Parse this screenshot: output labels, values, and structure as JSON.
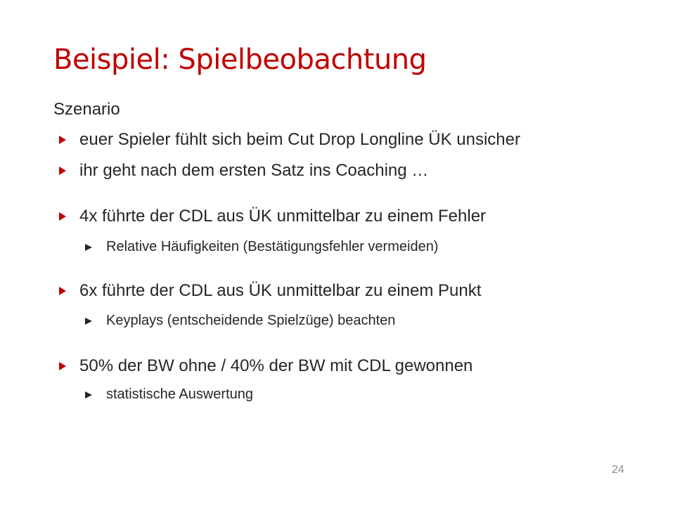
{
  "slide": {
    "title": "Beispiel: Spielbeobachtung",
    "subtitle": "Szenario",
    "bullets": [
      "euer Spieler fühlt sich beim Cut Drop Longline ÜK unsicher",
      "ihr geht nach dem ersten Satz ins Coaching …",
      "4x führte der CDL aus ÜK unmittelbar zu einem Fehler",
      "6x führte der CDL aus ÜK unmittelbar zu einem Punkt",
      "50% der BW ohne / 40% der BW mit CDL gewonnen"
    ],
    "sub_bullets": [
      "Relative Häufigkeiten (Bestätigungsfehler vermeiden)",
      "Keyplays (entscheidende Spielzüge) beachten",
      "statistische Auswertung"
    ],
    "page_number": "24"
  },
  "colors": {
    "accent": "#c00000",
    "text": "#262626",
    "page_number": "#8c8c8c"
  },
  "icons": {
    "bullet_marker": "red-triangle-right-icon",
    "sub_bullet_marker": "dark-triangle-right-icon"
  }
}
